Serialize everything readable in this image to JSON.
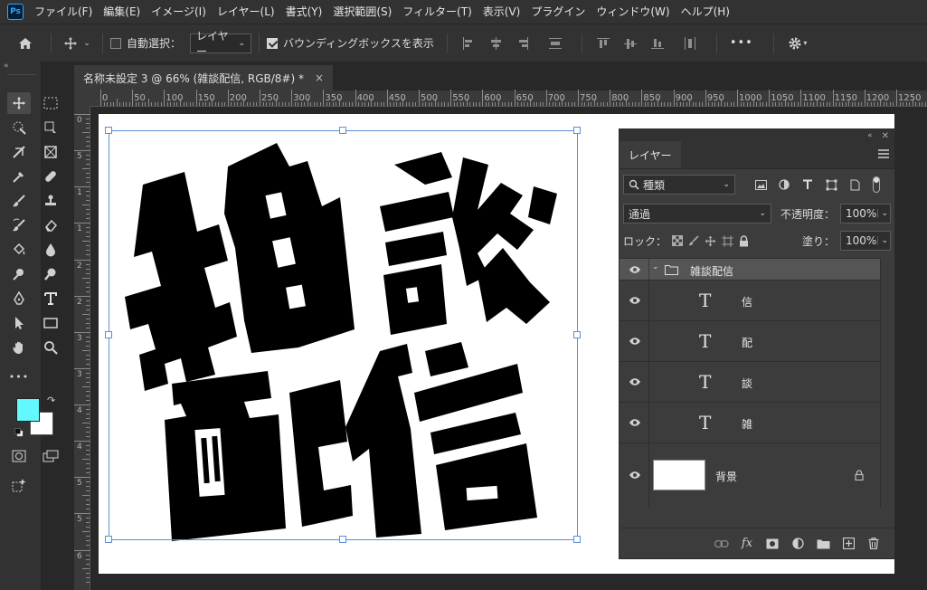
{
  "app": {
    "logo": "Ps"
  },
  "menu": [
    "ファイル(F)",
    "編集(E)",
    "イメージ(I)",
    "レイヤー(L)",
    "書式(Y)",
    "選択範囲(S)",
    "フィルター(T)",
    "表示(V)",
    "プラグイン",
    "ウィンドウ(W)",
    "ヘルプ(H)"
  ],
  "options": {
    "auto_select_label": "自動選択：",
    "auto_select_checked": false,
    "target_value": "レイヤー",
    "bbox_label": "バウンディングボックスを表示",
    "bbox_checked": true,
    "more": "•••"
  },
  "document_tab": {
    "title": "名称未設定 3 @ 66% (雑談配信, RGB/8#) *",
    "close": "×"
  },
  "ruler": {
    "labels": [
      "0",
      "50",
      "100",
      "150",
      "200",
      "250",
      "300",
      "350",
      "400",
      "450",
      "500",
      "550",
      "600",
      "650",
      "700",
      "750",
      "800",
      "850",
      "900",
      "950",
      "1000",
      "1050",
      "1100",
      "1150",
      "1200",
      "1250"
    ],
    "vertical_labels": [
      "0",
      "5",
      "1",
      "1",
      "2",
      "2",
      "3",
      "3",
      "4",
      "4",
      "5",
      "5",
      "6"
    ]
  },
  "artwork": {
    "lines": [
      "雑談",
      "配信"
    ]
  },
  "layers_panel": {
    "tab": "レイヤー",
    "filter_label": "種類",
    "blend_mode": "通過",
    "opacity_label": "不透明度：",
    "opacity_value": "100%",
    "lock_label": "ロック：",
    "fill_label": "塗り：",
    "fill_value": "100%",
    "group": {
      "name": "雑談配信"
    },
    "layers": [
      {
        "name": "信",
        "kind": "T"
      },
      {
        "name": "配",
        "kind": "T"
      },
      {
        "name": "談",
        "kind": "T"
      },
      {
        "name": "雑",
        "kind": "T"
      }
    ],
    "background": {
      "name": "背景"
    }
  },
  "colors": {
    "foreground": "#62f8fd",
    "background": "#ffffff",
    "accent": "#5b8fd6"
  }
}
